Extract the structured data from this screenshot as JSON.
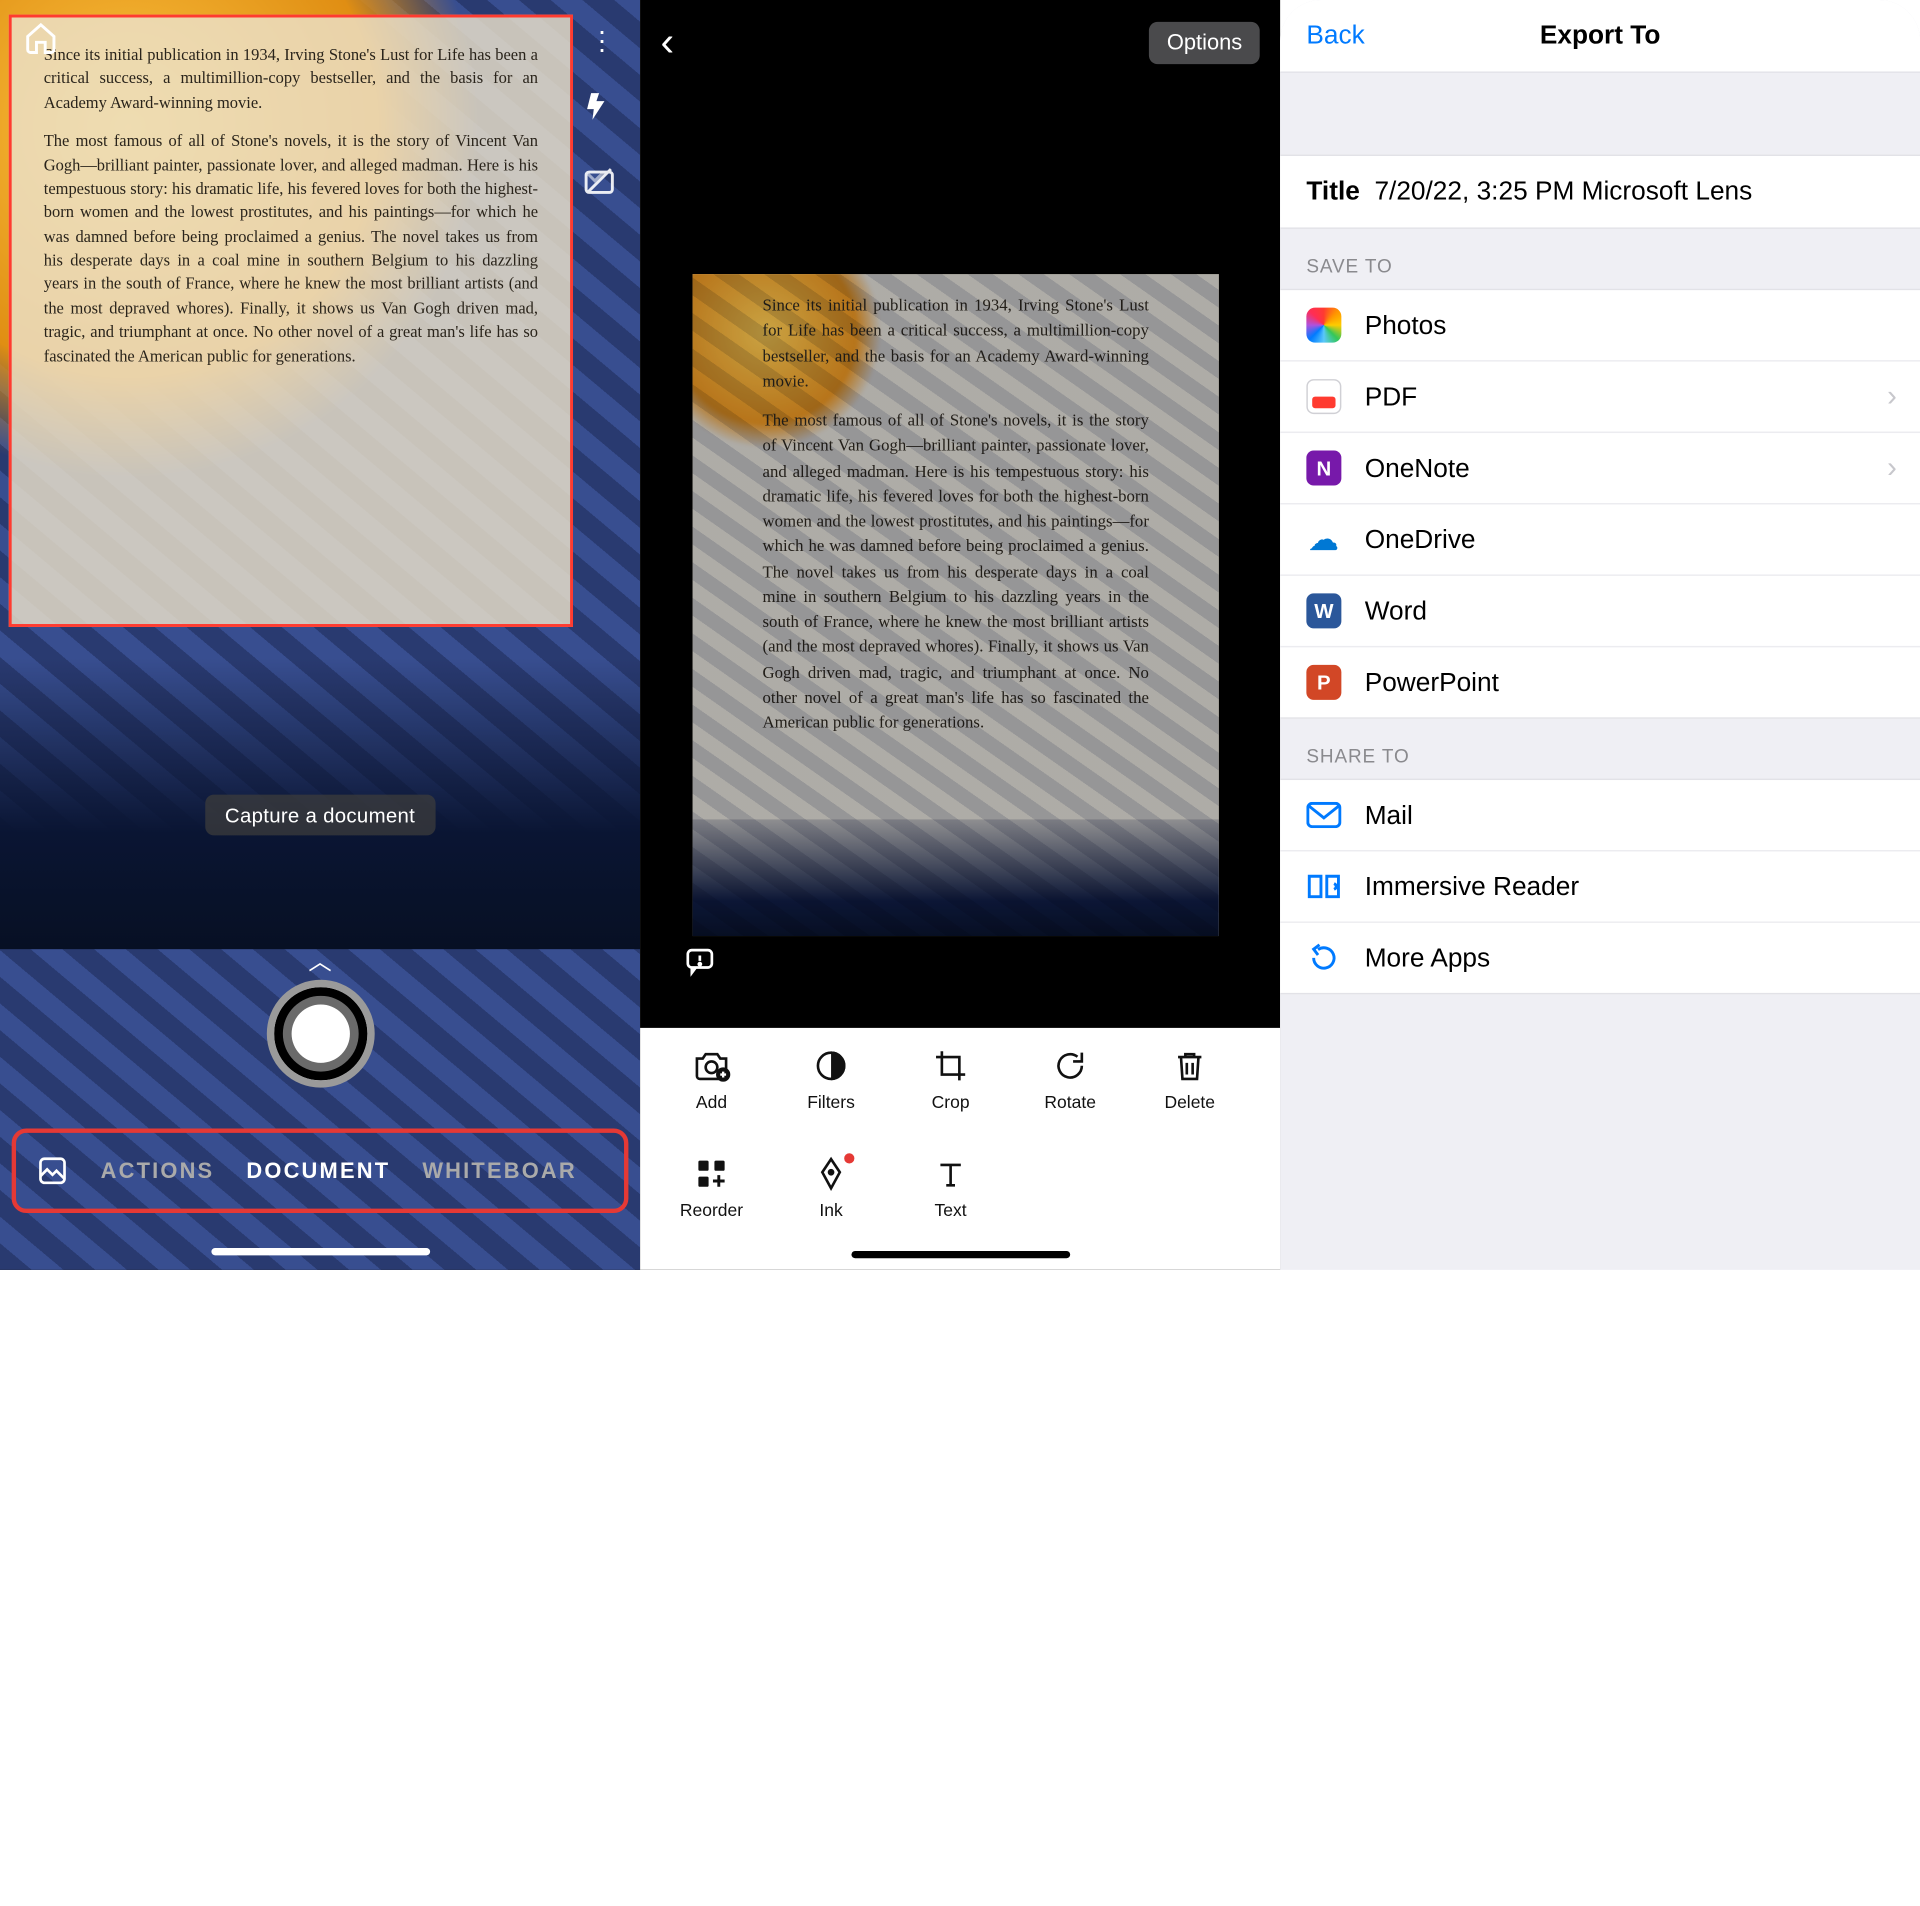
{
  "document_text": {
    "para1": "Since its initial publication in 1934, Irving Stone's Lust for Life has been a critical success, a multimillion-copy bestseller, and the basis for an Academy Award-winning movie.",
    "para2": "The most famous of all of Stone's novels, it is the story of Vincent Van Gogh—brilliant painter, passionate lover, and alleged madman. Here is his tempestuous story: his dramatic life, his fevered loves for both the highest-born women and the lowest prostitutes, and his paintings—for which he was damned before being proclaimed a genius. The novel takes us from his desperate days in a coal mine in southern Belgium to his dazzling years in the south of France, where he knew the most brilliant artists (and the most depraved whores). Finally, it shows us Van Gogh driven mad, tragic, and triumphant at once. No other novel of a great man's life has so fascinated the American public for generations."
  },
  "panel1": {
    "hint": "Capture a document",
    "modes": [
      "ACTIONS",
      "DOCUMENT",
      "WHITEBOAR"
    ],
    "active_mode_index": 1
  },
  "panel2": {
    "options_label": "Options",
    "toolbar": [
      {
        "label": "Add"
      },
      {
        "label": "Filters"
      },
      {
        "label": "Crop"
      },
      {
        "label": "Rotate"
      },
      {
        "label": "Delete"
      },
      {
        "label": "Reorder"
      },
      {
        "label": "Ink"
      },
      {
        "label": "Text"
      }
    ]
  },
  "panel3": {
    "back": "Back",
    "title": "Export To",
    "row_title_key": "Title",
    "row_title_value": "7/20/22, 3:25 PM Microsoft Lens",
    "save_to_header": "SAVE TO",
    "share_to_header": "SHARE TO",
    "save_to": [
      {
        "label": "Photos",
        "chevron": false
      },
      {
        "label": "PDF",
        "chevron": true
      },
      {
        "label": "OneNote",
        "chevron": true
      },
      {
        "label": "OneDrive",
        "chevron": false
      },
      {
        "label": "Word",
        "chevron": false
      },
      {
        "label": "PowerPoint",
        "chevron": false
      }
    ],
    "share_to": [
      {
        "label": "Mail"
      },
      {
        "label": "Immersive Reader"
      },
      {
        "label": "More Apps"
      }
    ]
  }
}
